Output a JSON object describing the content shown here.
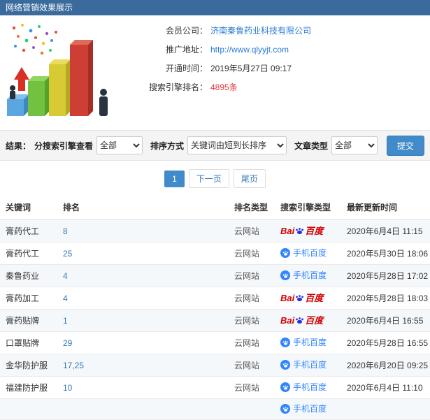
{
  "header": {
    "title": "网络营销效果展示"
  },
  "info": {
    "rows": [
      {
        "label": "会员公司：",
        "value": "济南秦鲁药业科技有限公司",
        "type": "link"
      },
      {
        "label": "推广地址：",
        "value": "http://www.qlyyjt.com",
        "type": "link"
      },
      {
        "label": "开通时间：",
        "value": "2019年5月27日 09:17",
        "type": "text"
      },
      {
        "label": "搜索引擎排名：",
        "value": "4895条",
        "type": "highlight"
      }
    ]
  },
  "filters": {
    "result_label": "结果：",
    "engine_label": "分搜索引擎查看",
    "engine_value": "全部",
    "sort_label": "排序方式",
    "sort_value": "关键词由短到长排序",
    "article_label": "文章类型",
    "article_value": "全部",
    "submit_label": "提交"
  },
  "pagination": {
    "current": "1",
    "next": "下一页",
    "last": "尾页"
  },
  "table": {
    "headers": [
      "关键词",
      "排名",
      "排名类型",
      "搜索引擎类型",
      "最新更新时间"
    ],
    "engine_labels": {
      "baidu_prefix": "Bai",
      "baidu_suffix": "百度",
      "mobile": "手机百度"
    },
    "rows": [
      {
        "keyword": "膏药代工",
        "rank": "8",
        "rank_type": "云网站",
        "engine": "baidu",
        "updated": "2020年6月4日 11:15"
      },
      {
        "keyword": "膏药代工",
        "rank": "25",
        "rank_type": "云网站",
        "engine": "mobile",
        "updated": "2020年5月30日 18:06"
      },
      {
        "keyword": "秦鲁药业",
        "rank": "4",
        "rank_type": "云网站",
        "engine": "mobile",
        "updated": "2020年5月28日 17:02"
      },
      {
        "keyword": "膏药加工",
        "rank": "4",
        "rank_type": "云网站",
        "engine": "baidu",
        "updated": "2020年5月28日 18:03"
      },
      {
        "keyword": "膏药贴牌",
        "rank": "1",
        "rank_type": "云网站",
        "engine": "baidu",
        "updated": "2020年6月4日 16:55"
      },
      {
        "keyword": "口罩贴牌",
        "rank": "29",
        "rank_type": "云网站",
        "engine": "mobile",
        "updated": "2020年5月28日 16:55"
      },
      {
        "keyword": "金华防护服",
        "rank": "17,25",
        "rank_type": "云网站",
        "engine": "mobile",
        "updated": "2020年6月20日 09:25"
      },
      {
        "keyword": "福建防护服",
        "rank": "10",
        "rank_type": "云网站",
        "engine": "mobile",
        "updated": "2020年6月4日 11:10"
      },
      {
        "keyword": "",
        "rank": "",
        "rank_type": "",
        "engine": "mobile",
        "updated": ""
      }
    ]
  },
  "colors": {
    "titlebar_bg": "#3a6b9c",
    "link_blue": "#2b7bd3",
    "highlight_red": "#e4393c",
    "accent_blue": "#428bca",
    "baidu_red": "#d20000",
    "baidu_paw_blue": "#2932e1",
    "mobile_blue": "#3385ff"
  }
}
